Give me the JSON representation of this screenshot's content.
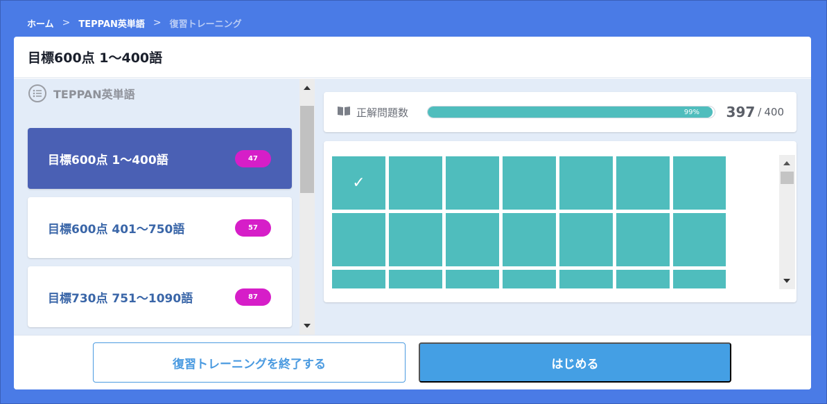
{
  "breadcrumb": {
    "items": [
      "ホーム",
      "TEPPAN英単語",
      "復習トレーニング"
    ],
    "separator": ">"
  },
  "header": {
    "title": "目標600点 1〜400語"
  },
  "course_list": {
    "heading": "TEPPAN英単語",
    "heading_icon": "list-icon",
    "items": [
      {
        "label": "目標600点 1〜400語",
        "count": "47",
        "active": true
      },
      {
        "label": "目標600点 401〜750語",
        "count": "57",
        "active": false
      },
      {
        "label": "目標730点 751〜1090語",
        "count": "87",
        "active": false
      }
    ]
  },
  "progress": {
    "icon": "book-icon",
    "label": "正解問題数",
    "percent_text": "99%",
    "fraction": 0.9925,
    "done": "397",
    "slash": "/",
    "total": "400"
  },
  "grid": {
    "columns": 7,
    "visible_rows": 3,
    "checked_index": 0,
    "check_glyph": "✓"
  },
  "colors": {
    "background": "#4a7be6",
    "active_course": "#4a60b4",
    "badge": "#d61ec8",
    "progress_fill": "#4fbdbd",
    "primary_button": "#449fe4"
  },
  "footer": {
    "end_button": "復習トレーニングを終了する",
    "start_button": "はじめる"
  }
}
